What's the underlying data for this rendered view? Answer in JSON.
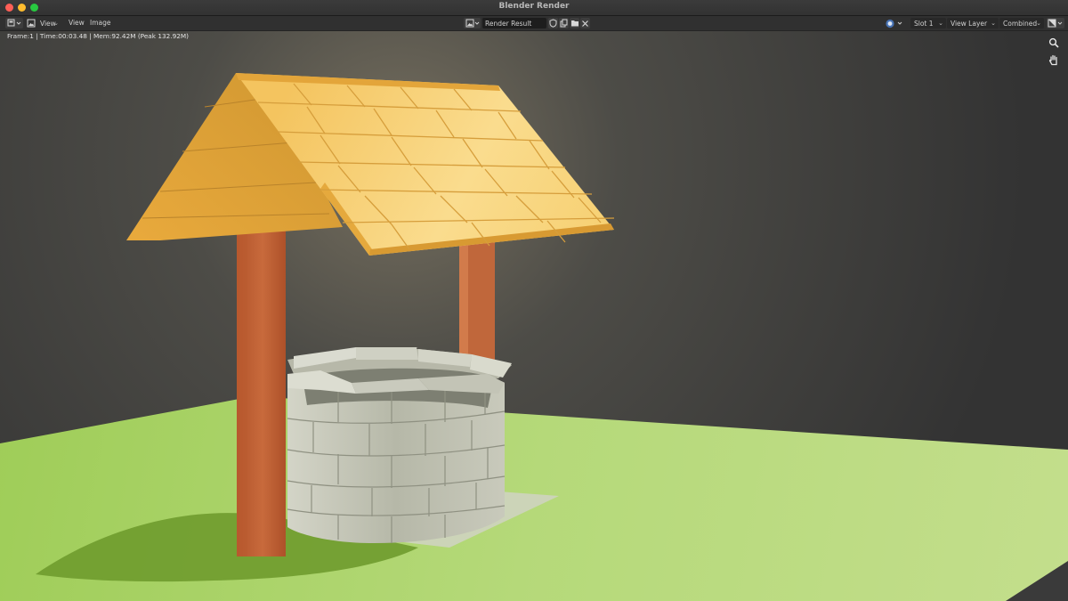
{
  "window": {
    "title": "Blender Render"
  },
  "header": {
    "menu_view": "View",
    "menu_view_left": "View",
    "menu_image": "Image",
    "image_name": "Render Result",
    "slot": "Slot 1",
    "view_layer": "View Layer",
    "pass": "Combined"
  },
  "status": {
    "text": "Frame:1 | Time:00:03.48 | Mem:92.42M (Peak 132.92M)"
  },
  "colors": {
    "ground": "#b7da78",
    "roof": "#f0b94c",
    "post": "#c26236",
    "stone": "#c2c3b3",
    "background": "#3b3b3b"
  },
  "icons": [
    "editor-type-icon",
    "image-icon",
    "shield-icon",
    "duplicate-icon",
    "folder-icon",
    "close-icon",
    "display-mode-icon",
    "channel-icon",
    "zoom-icon",
    "hand-icon"
  ]
}
